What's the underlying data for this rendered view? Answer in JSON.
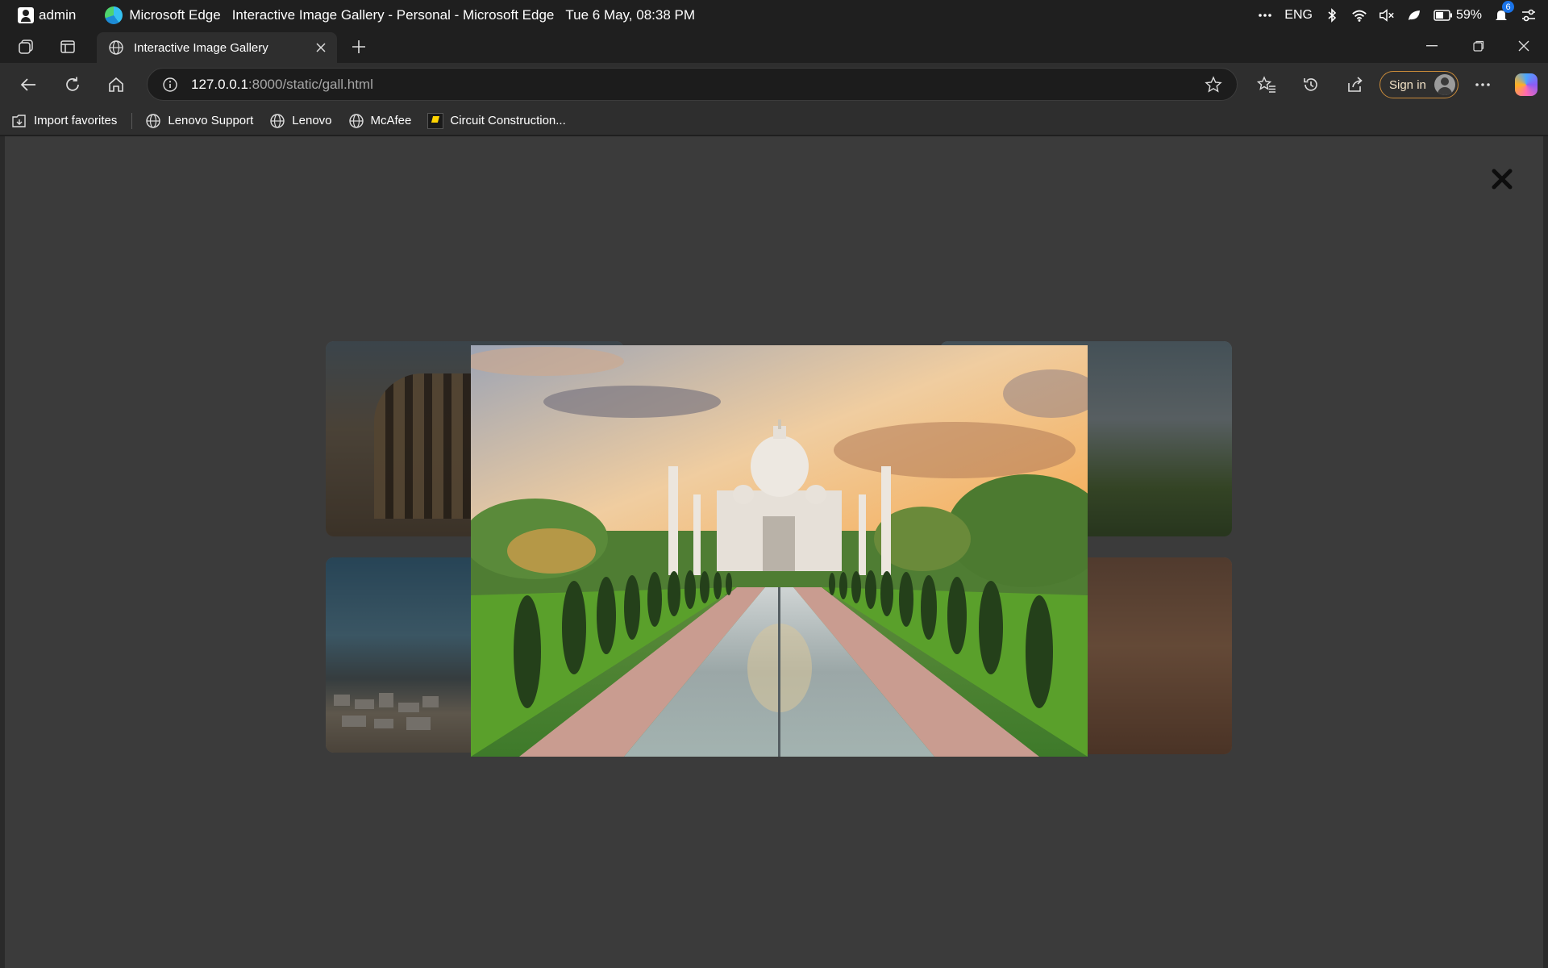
{
  "system": {
    "user": "admin",
    "app_name": "Microsoft Edge",
    "window_title": "Interactive Image Gallery - Personal - Microsoft Edge",
    "datetime": "Tue 6 May, 08:38 PM",
    "language": "ENG",
    "battery": "59%",
    "notification_count": "6"
  },
  "tab": {
    "title": "Interactive Image Gallery"
  },
  "address": {
    "host": "127.0.0.1",
    "path": ":8000/static/gall.html"
  },
  "toolbar": {
    "sign_in_label": "Sign in"
  },
  "favorites": [
    {
      "label": "Import favorites",
      "icon": "import-icon"
    },
    {
      "label": "Lenovo Support",
      "icon": "globe-icon"
    },
    {
      "label": "Lenovo",
      "icon": "globe-icon"
    },
    {
      "label": "McAfee",
      "icon": "globe-icon"
    },
    {
      "label": "Circuit Construction...",
      "icon": "phet-icon"
    }
  ],
  "gallery": {
    "lightbox_open": true,
    "thumbnails": [
      "colosseum-thumbnail",
      "taj-mahal-thumbnail",
      "coastal-city-thumbnail",
      "petra-thumbnail"
    ],
    "featured_image": "taj-mahal-photo"
  },
  "colors": {
    "page_background": "#3b3b3b",
    "browser_chrome": "#2e2e2e",
    "title_bar": "#1f1f1f",
    "sign_in_border": "#c98b3a"
  }
}
